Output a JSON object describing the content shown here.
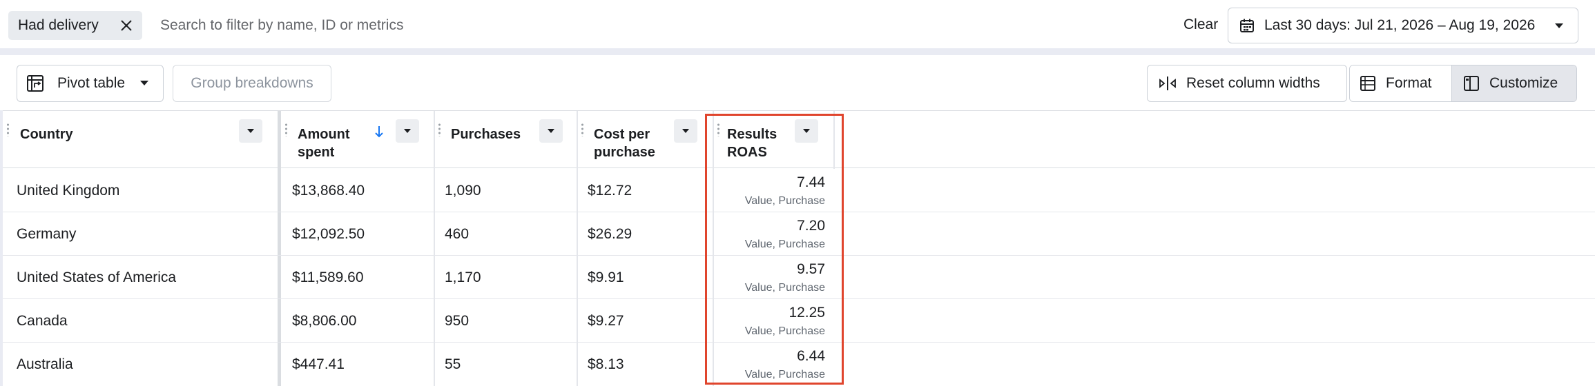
{
  "filter_bar": {
    "chip_label": "Had delivery",
    "search_placeholder": "Search to filter by name, ID or metrics",
    "clear_label": "Clear",
    "date_range_label": "Last 30 days: Jul 21, 2026 – Aug 19, 2026"
  },
  "toolbar": {
    "pivot_label": "Pivot table",
    "group_label": "Group breakdowns",
    "reset_label": "Reset column widths",
    "format_label": "Format",
    "customize_label": "Customize"
  },
  "table": {
    "columns": [
      {
        "line1": "Country",
        "line2": ""
      },
      {
        "line1": "Amount",
        "line2": "spent"
      },
      {
        "line1": "Purchases",
        "line2": ""
      },
      {
        "line1": "Cost per",
        "line2": "purchase"
      },
      {
        "line1": "Results",
        "line2": "ROAS"
      }
    ],
    "sorted_column": "Amount spent",
    "sort_direction": "descending",
    "roas_subtitle": "Value, Purchase",
    "rows": [
      {
        "country": "United Kingdom",
        "amount": "$13,868.40",
        "purchases": "1,090",
        "cpp": "$12.72",
        "roas": "7.44",
        "roas_sub": "Value, Purchase"
      },
      {
        "country": "Germany",
        "amount": "$12,092.50",
        "purchases": "460",
        "cpp": "$26.29",
        "roas": "7.20",
        "roas_sub": "Value, Purchase"
      },
      {
        "country": "United States of America",
        "amount": "$11,589.60",
        "purchases": "1,170",
        "cpp": "$9.91",
        "roas": "9.57",
        "roas_sub": "Value, Purchase"
      },
      {
        "country": "Canada",
        "amount": "$8,806.00",
        "purchases": "950",
        "cpp": "$9.27",
        "roas": "12.25",
        "roas_sub": "Value, Purchase"
      },
      {
        "country": "Australia",
        "amount": "$447.41",
        "purchases": "55",
        "cpp": "$8.13",
        "roas": "6.44",
        "roas_sub": "Value, Purchase"
      }
    ]
  },
  "colors": {
    "highlight": "#e0452d",
    "sort_arrow": "#1877f2",
    "background": "#e9ebf3"
  }
}
